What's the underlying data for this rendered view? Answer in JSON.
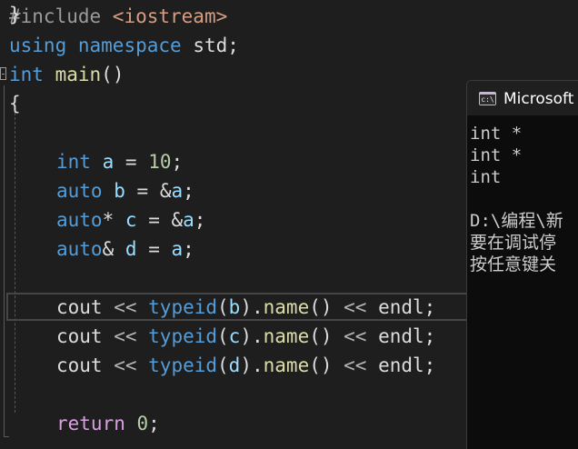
{
  "editor": {
    "line1": {
      "pre": "#include ",
      "inc": "<iostream>"
    },
    "line2": {
      "kw1": "using",
      "kw2": "namespace",
      "rest": " std;"
    },
    "line3": {
      "kw": "int",
      "fn": "main",
      "rest": "()"
    },
    "line4": {
      "text": "{"
    },
    "line6": {
      "kw": "int",
      "var": "a",
      "op": " = ",
      "num": "10",
      "end": ";"
    },
    "line7": {
      "kw": "auto",
      "var": "b",
      "op": " = ",
      "ref": "&",
      "var2": "a",
      "end": ";"
    },
    "line8": {
      "kw": "auto",
      "star": "*",
      "var": "c",
      "op": " = ",
      "ref": "&",
      "var2": "a",
      "end": ";"
    },
    "line9": {
      "kw": "auto",
      "amp": "&",
      "var": "d",
      "op": " = ",
      "var2": "a",
      "end": ";"
    },
    "cout_line": {
      "cout": "cout",
      "shl": " << ",
      "typeid": "typeid",
      "dot": ".",
      "name": "name",
      "paren": "()",
      "endl": "endl",
      "end": ";"
    },
    "line11_arg": "b",
    "line12_arg": "c",
    "line13_arg": "d",
    "line15": {
      "kw": "return",
      "num": "0",
      "end": ";"
    },
    "line16": {
      "text": "}"
    }
  },
  "console": {
    "title": "Microsoft Visual Studio 调试控制台",
    "icon_label": "c:\\",
    "lines": [
      "int *",
      "int *",
      "int",
      "D:\\编程\\新",
      "要在调试停",
      "按任意键关"
    ]
  },
  "colors": {
    "background": "#1e1e1e",
    "keyword": "#569cd6",
    "function": "#dcdcaa",
    "string_include": "#d69d85",
    "number": "#b5cea8",
    "variable": "#9cdcfe",
    "return_keyword": "#d8a0df",
    "console_bg": "#0c0c0c"
  }
}
